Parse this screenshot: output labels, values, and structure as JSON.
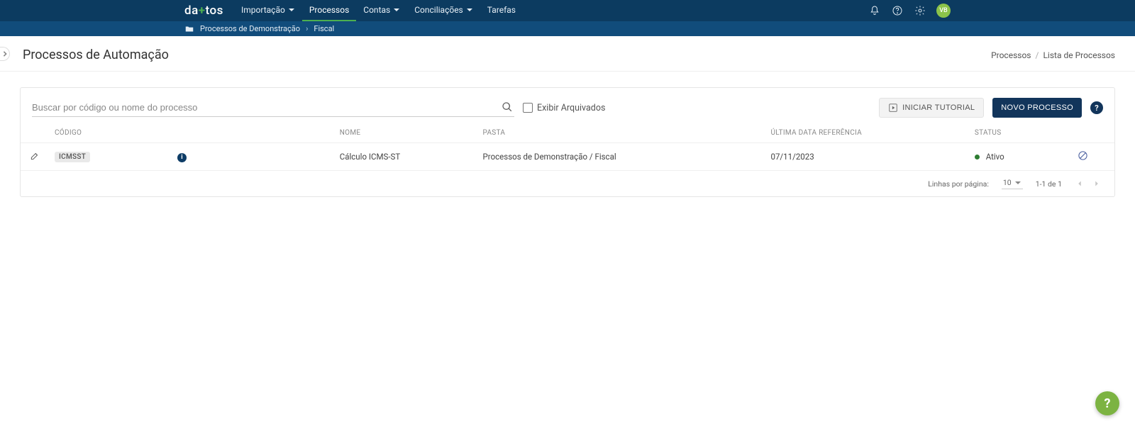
{
  "brand": {
    "name_left": "da",
    "name_plus": "+",
    "name_right": "tos"
  },
  "nav": {
    "items": [
      {
        "label": "Importação",
        "has_dropdown": true
      },
      {
        "label": "Processos",
        "has_dropdown": false,
        "active": true
      },
      {
        "label": "Contas",
        "has_dropdown": true
      },
      {
        "label": "Conciliações",
        "has_dropdown": true
      },
      {
        "label": "Tarefas",
        "has_dropdown": false
      }
    ]
  },
  "user": {
    "initials": "VB"
  },
  "subnav": {
    "folder": "Processos de Demonstração",
    "leaf": "Fiscal"
  },
  "page": {
    "title": "Processos de Automação"
  },
  "breadcrumb": {
    "root": "Processos",
    "leaf": "Lista de Processos"
  },
  "toolbar": {
    "search_placeholder": "Buscar por código ou nome do processo",
    "show_archived_label": "Exibir Arquivados",
    "tutorial_btn": "Iniciar Tutorial",
    "new_process_btn": "Novo Processo"
  },
  "table": {
    "headers": {
      "codigo": "Código",
      "nome": "Nome",
      "pasta": "Pasta",
      "ultima": "Última Data Referência",
      "status": "Status"
    },
    "rows": [
      {
        "codigo": "ICMSST",
        "nome": "Cálculo ICMS-ST",
        "pasta": "Processos de Demonstração / Fiscal",
        "ultima": "07/11/2023",
        "status": "Ativo"
      }
    ]
  },
  "pagination": {
    "rows_label": "Linhas por página:",
    "rows_value": "10",
    "range": "1-1 de 1"
  }
}
